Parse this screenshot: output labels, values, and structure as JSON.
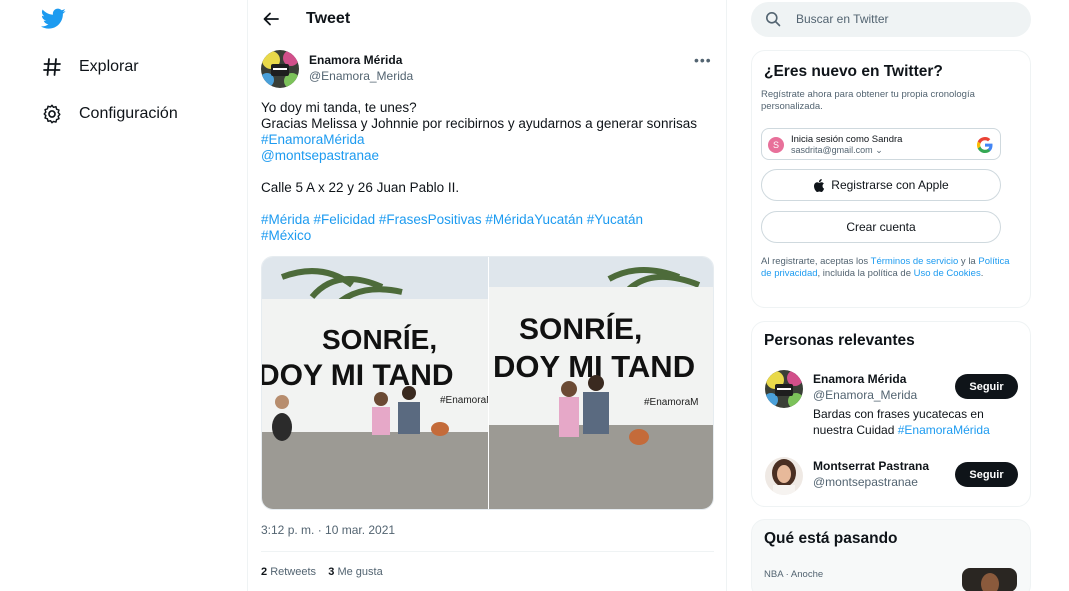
{
  "nav": {
    "logo": "twitter-bird-icon",
    "items": [
      {
        "label": "Explorar",
        "icon": "hashtag-icon"
      },
      {
        "label": "Configuración",
        "icon": "gear-icon"
      }
    ]
  },
  "header": {
    "title": "Tweet",
    "back_icon": "back-arrow-icon"
  },
  "tweet": {
    "author_name": "Enamora Mérida",
    "author_handle": "@Enamora_Merida",
    "text_lines": [
      "Yo doy mi tanda, te unes?",
      "Gracias Melissa y Johnnie por recibirnos y ayudarnos a generar sonrisas"
    ],
    "mention_tag": "#EnamoraMérida",
    "mention_user": "@montsepastranae",
    "address": "Calle 5 A x 22 y 26 Juan Pablo II.",
    "hashtags_line1": [
      "#Mérida",
      "#Felicidad",
      "#FrasesPositivas",
      "#MéridaYucatán",
      "#Yucatán"
    ],
    "hashtags_line2": [
      "#México"
    ],
    "photo1_text_top": "SONRÍE,",
    "photo1_text_bottom": "DOY MI TAND",
    "photo_tag": "#EnamoraM",
    "photo2_text_top": "SONRÍE,",
    "photo2_text_bottom": "DOY MI TAND",
    "timestamp": "3:12 p. m. · 10 mar. 2021",
    "retweets_count": "2",
    "retweets_label": "Retweets",
    "likes_count": "3",
    "likes_label": "Me gusta"
  },
  "search": {
    "placeholder": "Buscar en Twitter"
  },
  "signup": {
    "title": "¿Eres nuevo en Twitter?",
    "subtitle": "Regístrate ahora para obtener tu propia cronología personalizada.",
    "google_line1": "Inicia sesión como Sandra",
    "google_line2": "sasdrita@gmail.com",
    "google_avatar_letter": "S",
    "apple_label": "Registrarse con Apple",
    "create_label": "Crear cuenta",
    "legal_prefix": "Al registrarte, aceptas los ",
    "terms": "Términos de servicio",
    "legal_mid1": " y la ",
    "privacy": "Política de privacidad",
    "legal_mid2": ", incluida la política de ",
    "cookies": "Uso de Cookies",
    "legal_end": "."
  },
  "relevant": {
    "title": "Personas relevantes",
    "people": [
      {
        "name": "Enamora Mérida",
        "handle": "@Enamora_Merida",
        "bio": "Bardas con frases yucatecas en nuestra Cuidad ",
        "bio_link": "#EnamoraMérida",
        "follow": "Seguir"
      },
      {
        "name": "Montserrat Pastrana",
        "handle": "@montsepastranae",
        "follow": "Seguir"
      }
    ]
  },
  "trending": {
    "title": "Qué está pasando",
    "item_meta": "NBA · Anoche"
  },
  "colors": {
    "accent": "#1d9bf0",
    "text": "#0f1419",
    "muted": "#536471"
  }
}
